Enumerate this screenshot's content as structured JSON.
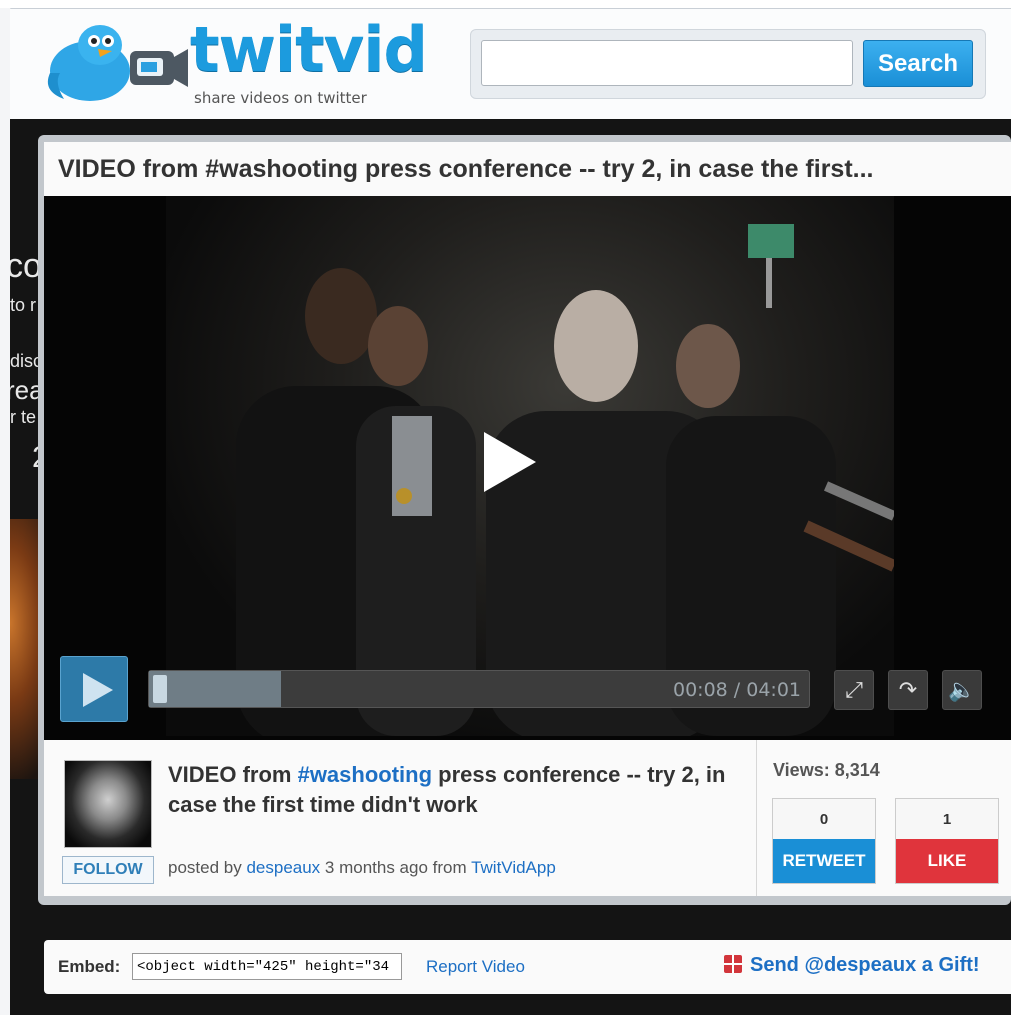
{
  "brand": {
    "name": "twitvid",
    "tagline": "share videos on twitter"
  },
  "search": {
    "button_label": "Search",
    "placeholder": ""
  },
  "video": {
    "title": "VIDEO from #washooting press conference -- try 2, in case the first...",
    "current_time": "00:08",
    "duration": "04:01",
    "time_display": "00:08 / 04:01",
    "progress_fraction": 0.2
  },
  "info": {
    "desc_before": "VIDEO from ",
    "desc_hashtag": "#washooting",
    "desc_after": " press conference -- try 2, in case the first time didn't work",
    "posted_prefix": "posted by ",
    "author": "despeaux",
    "time_ago": " 3 months ago from ",
    "source": "TwitVidApp",
    "follow_label": "FOLLOW"
  },
  "stats": {
    "views_label": "Views: 8,314",
    "retweet_count": "0",
    "retweet_label": "RETWEET",
    "like_count": "1",
    "like_label": "LIKE"
  },
  "embed": {
    "label": "Embed:",
    "code": "<object width=\"425\" height=\"34",
    "report_label": "Report Video",
    "gift_label": "Send @despeaux a Gift!"
  },
  "background_text": [
    "co",
    "to r",
    "disc",
    "rea",
    "r te",
    "2"
  ],
  "colors": {
    "brand_blue": "#1c9bde",
    "link_blue": "#1d6fc4",
    "retweet_blue": "#1a8fd6",
    "like_red": "#e0343c"
  },
  "icons": {
    "player_play": "play-icon",
    "fullscreen": "fullscreen-icon",
    "share": "share-arrow-icon",
    "volume": "volume-icon",
    "gift": "gift-icon"
  }
}
